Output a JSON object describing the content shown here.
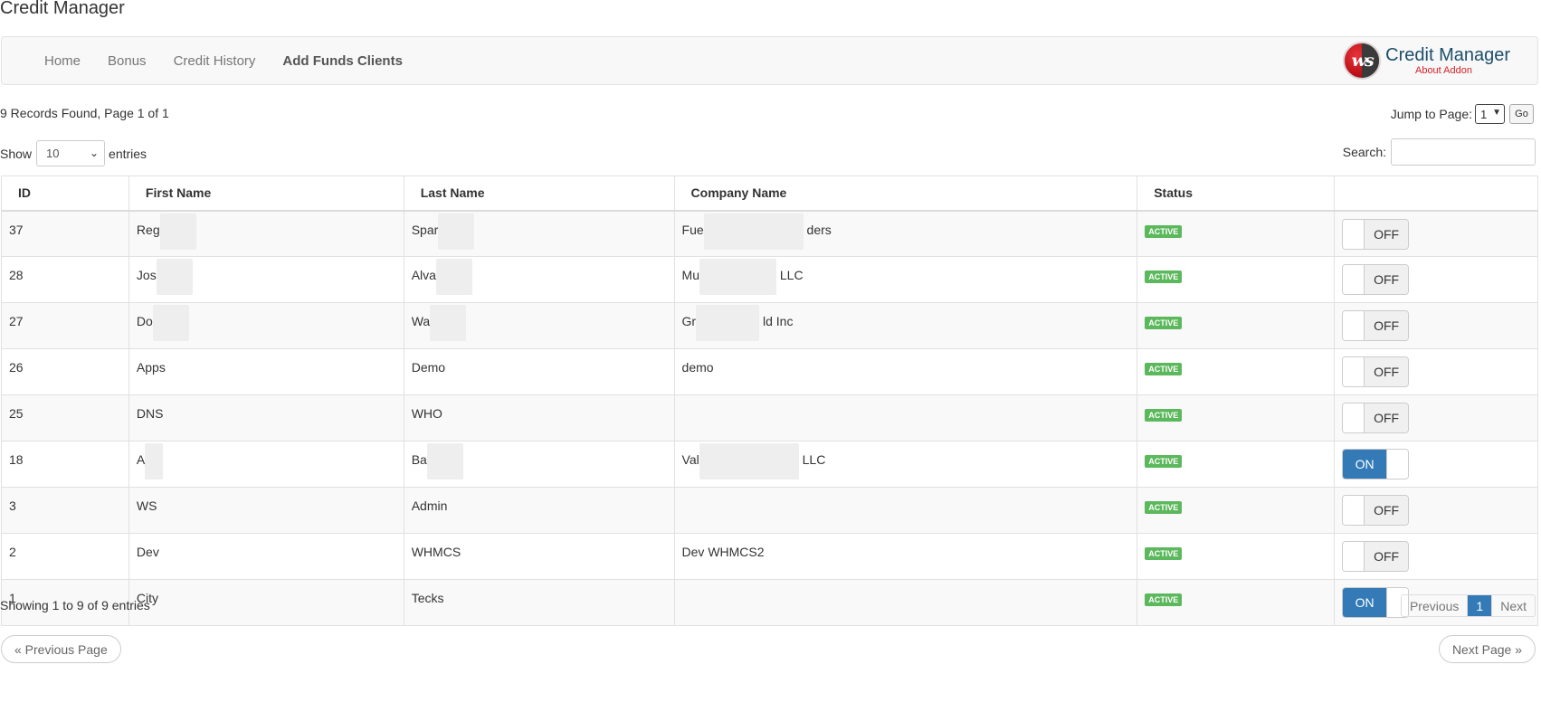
{
  "page": {
    "title": "Credit Manager"
  },
  "nav": {
    "items": [
      {
        "label": "Home",
        "active": false
      },
      {
        "label": "Bonus",
        "active": false
      },
      {
        "label": "Credit History",
        "active": false
      },
      {
        "label": "Add Funds Clients",
        "active": true
      }
    ]
  },
  "brand": {
    "name": "Credit Manager",
    "sub": "About Addon",
    "logo_mark": "ws",
    "colors": {
      "red": "#d61f26",
      "blue": "#1d4e6b"
    }
  },
  "records": {
    "summary": "9 Records Found, Page 1 of 1"
  },
  "jump": {
    "label": "Jump to Page:",
    "selected": "1",
    "go_label": "Go"
  },
  "length": {
    "show_label": "Show",
    "selected": "10",
    "entries_label": "entries"
  },
  "search": {
    "label": "Search:",
    "value": ""
  },
  "table": {
    "columns": [
      "ID",
      "First Name",
      "Last Name",
      "Company Name",
      "Status",
      ""
    ],
    "rows": [
      {
        "id": "37",
        "first": "Reg",
        "last": "Spar",
        "company": "Fue",
        "company_tail": "ders",
        "status": "ACTIVE",
        "toggle": "OFF",
        "on": false
      },
      {
        "id": "28",
        "first": "Jos",
        "last": "Alva",
        "company": "Mu",
        "company_tail": "LLC",
        "status": "ACTIVE",
        "toggle": "OFF",
        "on": false
      },
      {
        "id": "27",
        "first": "Do",
        "last": "Wa",
        "company": "Gr",
        "company_tail": "ld Inc",
        "status": "ACTIVE",
        "toggle": "OFF",
        "on": false
      },
      {
        "id": "26",
        "first": "Apps",
        "last": "Demo",
        "company": "demo",
        "company_tail": "",
        "status": "ACTIVE",
        "toggle": "OFF",
        "on": false
      },
      {
        "id": "25",
        "first": "DNS",
        "last": "WHO",
        "company": "",
        "company_tail": "",
        "status": "ACTIVE",
        "toggle": "OFF",
        "on": false
      },
      {
        "id": "18",
        "first": "A",
        "last": "Ba",
        "company": "Val",
        "company_tail": "LLC",
        "status": "ACTIVE",
        "toggle": "ON",
        "on": true
      },
      {
        "id": "3",
        "first": "WS",
        "last": "Admin",
        "company": "",
        "company_tail": "",
        "status": "ACTIVE",
        "toggle": "OFF",
        "on": false
      },
      {
        "id": "2",
        "first": "Dev",
        "last": "WHMCS",
        "company": "Dev WHMCS2",
        "company_tail": "",
        "status": "ACTIVE",
        "toggle": "OFF",
        "on": false
      },
      {
        "id": "1",
        "first": "City",
        "last": "Tecks",
        "company": "",
        "company_tail": "",
        "status": "ACTIVE",
        "toggle": "ON",
        "on": true
      }
    ]
  },
  "footer": {
    "showing": "Showing 1 to 9 of 9 entries",
    "previous": "Previous",
    "current_page": "1",
    "next": "Next",
    "prev_page": "« Previous Page",
    "next_page": "Next Page »"
  },
  "colors": {
    "accent": "#337ab7",
    "active_badge": "#5cb85c"
  }
}
